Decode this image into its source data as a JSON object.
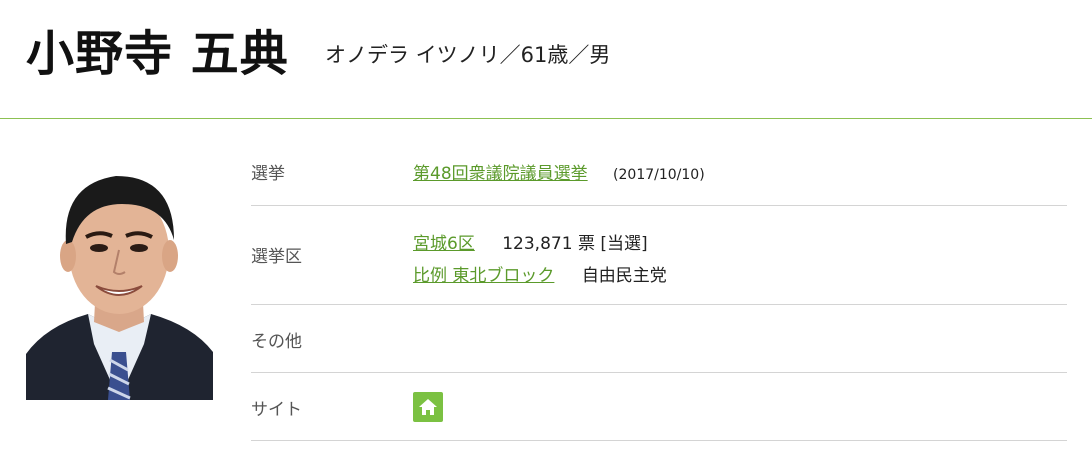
{
  "header": {
    "name": "小野寺 五典",
    "kana_info": "オノデラ イツノリ／61歳／男"
  },
  "rows": {
    "election": {
      "label": "選挙",
      "link": "第48回衆議院議員選挙",
      "date": "(2017/10/10)"
    },
    "district": {
      "label": "選挙区",
      "district_link": "宮城6区",
      "votes": "123,871 票 [当選]",
      "pr_link": "比例 東北ブロック",
      "party": "自由民主党"
    },
    "other": {
      "label": "その他"
    },
    "site": {
      "label": "サイト",
      "icon": "home-icon",
      "icon_color": "#7bc142"
    }
  },
  "colors": {
    "accent_line": "#8cc152",
    "link": "#5b9a2b"
  }
}
